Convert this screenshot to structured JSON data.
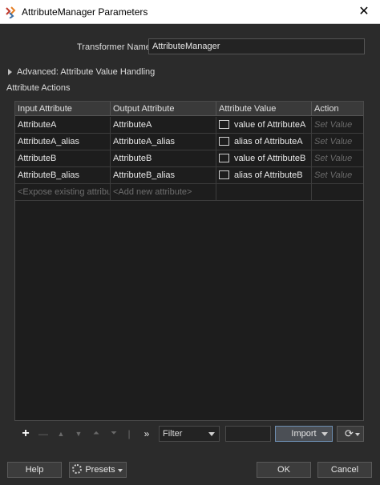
{
  "window": {
    "title": "AttributeManager Parameters",
    "close_glyph": "✕"
  },
  "form": {
    "transformer_label": "Transformer Name:",
    "transformer_value": "AttributeManager"
  },
  "advanced": {
    "label": "Advanced: Attribute Value Handling"
  },
  "section": {
    "label": "Attribute Actions"
  },
  "table": {
    "headers": [
      "Input Attribute",
      "Output Attribute",
      "Attribute Value",
      "Action"
    ],
    "rows": [
      {
        "input": "AttributeA",
        "output": "AttributeA",
        "value": "value of AttributeA",
        "action": "Set Value"
      },
      {
        "input": "AttributeA_alias",
        "output": "AttributeA_alias",
        "value": "alias of AttributeA",
        "action": "Set Value"
      },
      {
        "input": "AttributeB",
        "output": "AttributeB",
        "value": "value of AttributeB",
        "action": "Set Value"
      },
      {
        "input": "AttributeB_alias",
        "output": "AttributeB_alias",
        "value": "alias of AttributeB",
        "action": "Set Value"
      }
    ],
    "placeholder_input": "<Expose existing attribute>",
    "placeholder_output": "<Add new attribute>"
  },
  "toolbar": {
    "add": "+",
    "remove": "—",
    "move_up": "▲",
    "move_down": "▼",
    "move_top": "⏶",
    "move_bottom": "⏷",
    "separator": "|",
    "expand": "»",
    "filter_value": "Filter",
    "import_label": "Import",
    "refresh_glyph": "⟳"
  },
  "footer": {
    "help": "Help",
    "presets": "Presets",
    "ok": "OK",
    "cancel": "Cancel"
  },
  "colors": {
    "background": "#2b2b2b",
    "table_bg": "#1d1d1d",
    "accent_border": "#6e8fb2"
  },
  "icons": {
    "app": "fme-transformer-icon",
    "close": "close-icon",
    "add": "plus-icon",
    "remove": "minus-icon",
    "up": "arrow-up-icon",
    "down": "arrow-down-icon",
    "top": "move-top-icon",
    "bottom": "move-bottom-icon",
    "expand": "double-chevron-icon",
    "refresh": "refresh-icon",
    "presets": "gear-icon",
    "value_editor": "text-box-icon"
  }
}
